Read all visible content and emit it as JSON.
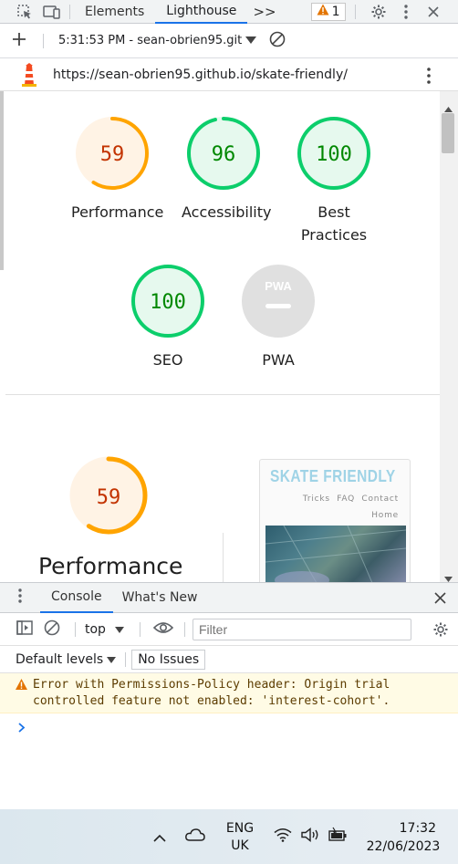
{
  "devtools": {
    "tabs": [
      {
        "label": "Elements"
      },
      {
        "label": "Lighthouse"
      }
    ],
    "more_tabs": ">>",
    "warning_count": "1"
  },
  "lighthouse": {
    "report_time": "5:31:53 PM - sean-obrien95.git",
    "report_url": "https://sean-obrien95.github.io/skate-friendly/",
    "gauges": [
      {
        "score": "59",
        "label": "Performance"
      },
      {
        "score": "96",
        "label": "Accessibility"
      },
      {
        "score": "100",
        "label": "Best Practices"
      },
      {
        "score": "100",
        "label": "SEO"
      },
      {
        "score": "",
        "label": "PWA"
      }
    ],
    "detail": {
      "score": "59",
      "label": "Performance"
    },
    "preview": {
      "title": "SKATE FRIENDLY",
      "nav": [
        "Tricks",
        "FAQ",
        "Contact",
        "Home"
      ]
    }
  },
  "drawer": {
    "tabs": [
      {
        "label": "Console"
      },
      {
        "label": "What's New"
      }
    ],
    "context": "top",
    "filter_placeholder": "Filter",
    "levels": "Default levels",
    "issues": "No Issues",
    "message": "Error with Permissions-Policy header: Origin trial controlled feature not enabled: 'interest-cohort'."
  },
  "taskbar": {
    "lang_top": "ENG",
    "lang_bottom": "UK",
    "time": "17:32",
    "date": "22/06/2023"
  },
  "colors": {
    "accent": "#1a73e8",
    "orange": "#ffa400",
    "orange_text": "#c33300",
    "green": "#0cce6b",
    "green_text": "#008800",
    "grey_gauge": "#e0e0e0"
  }
}
